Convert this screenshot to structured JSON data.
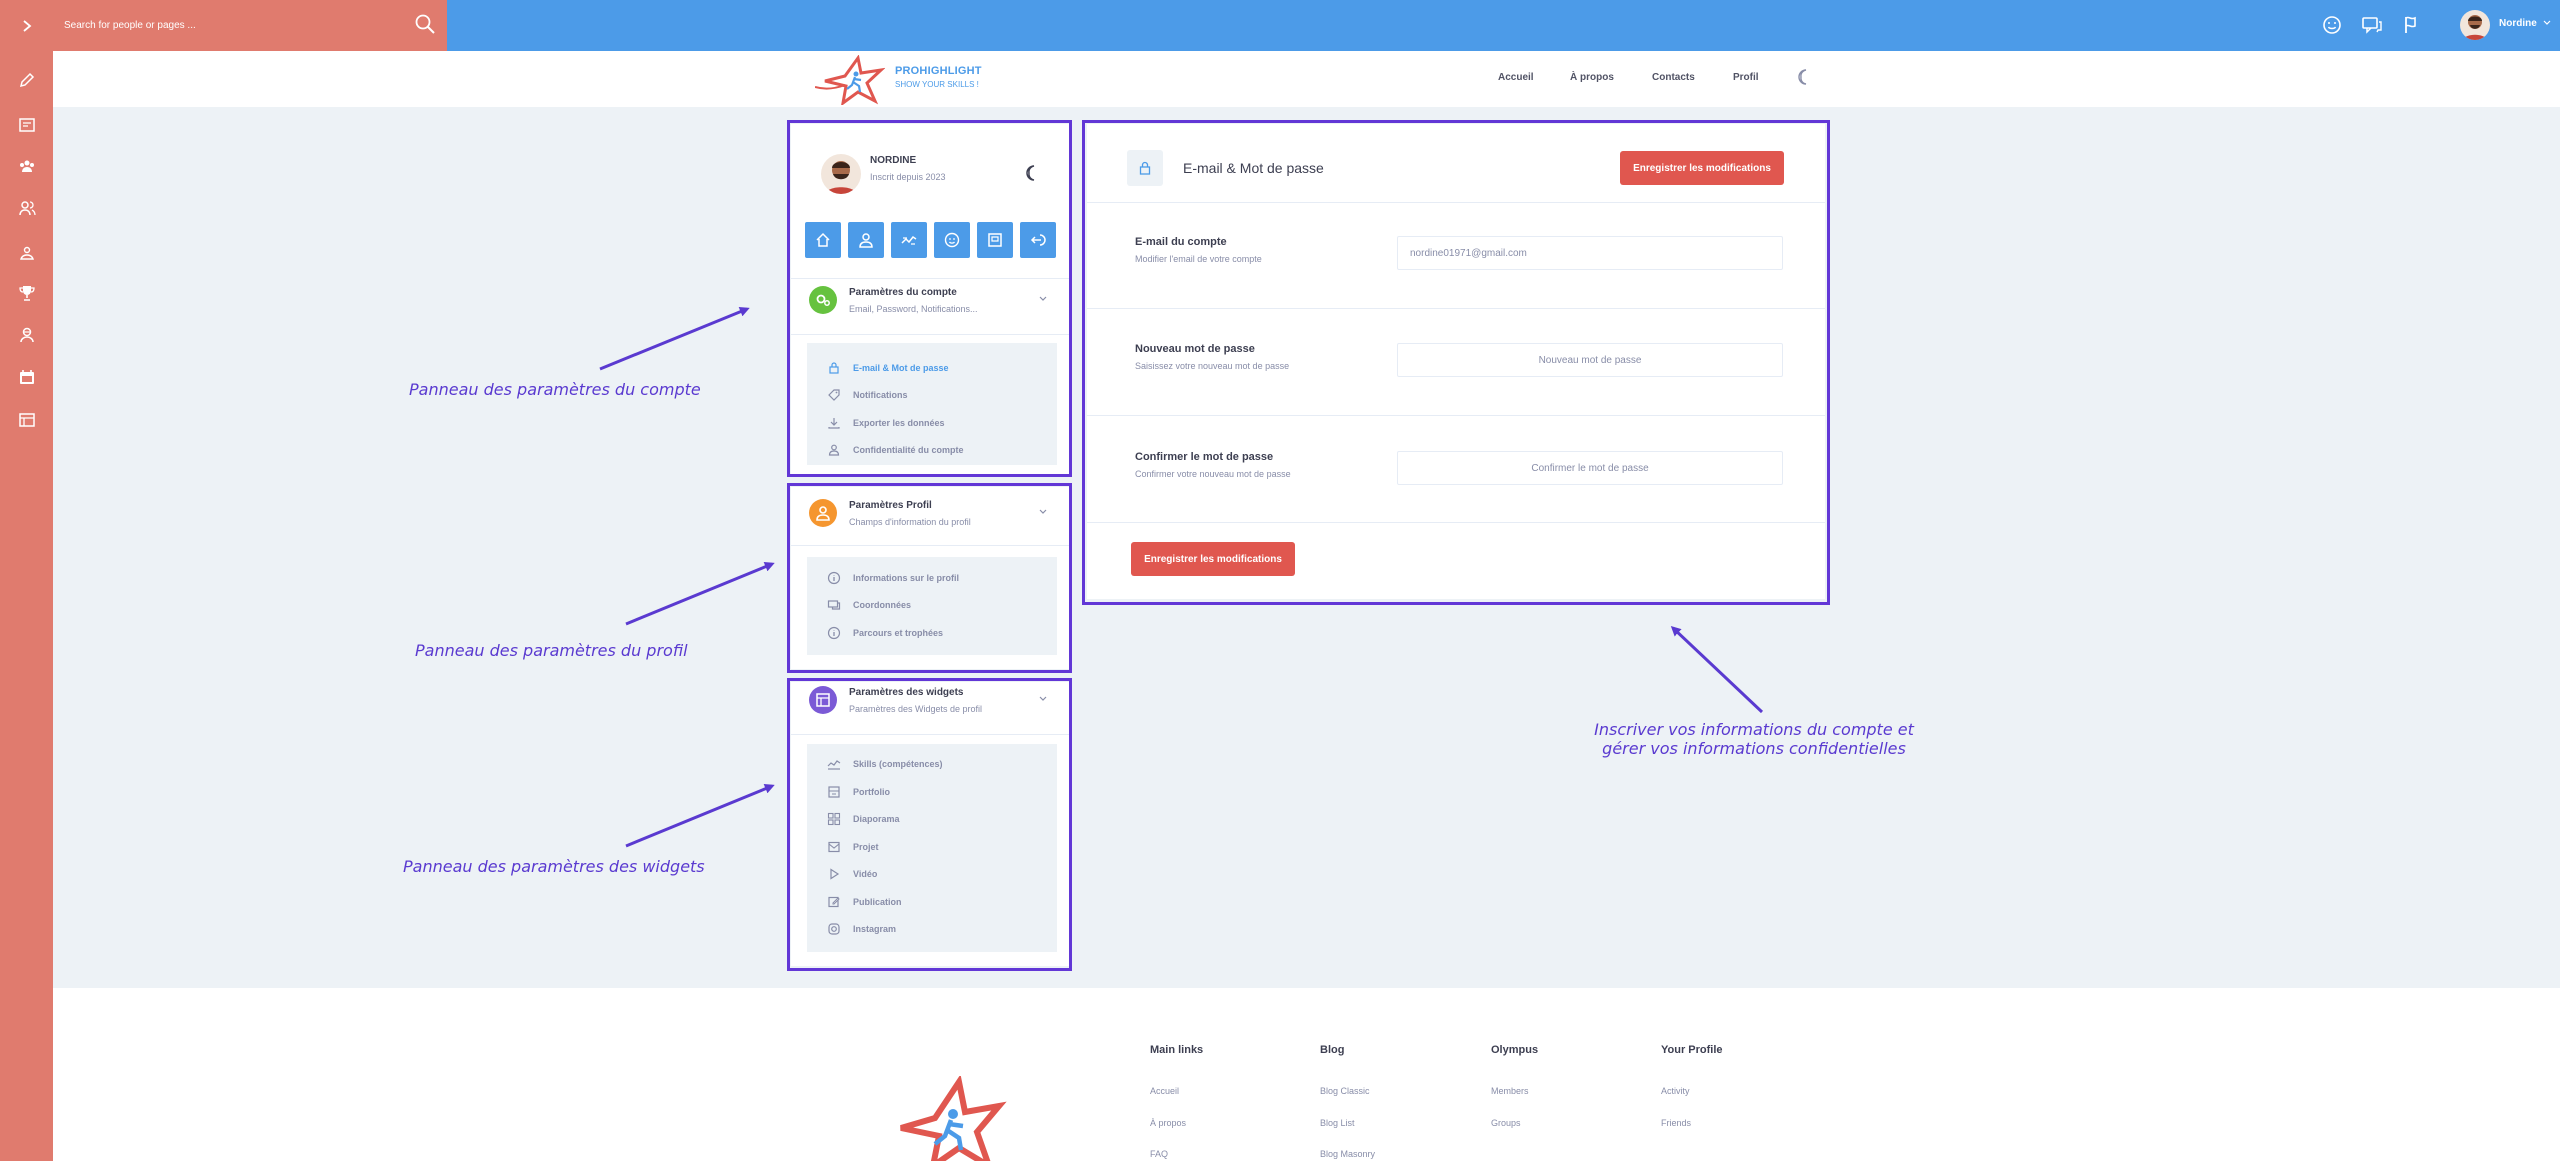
{
  "search": {
    "placeholder": "Search for people or pages ..."
  },
  "user": {
    "name": "Nordine"
  },
  "brand": {
    "name": "PROHIGHLIGHT",
    "tagline": "SHOW YOUR SKILLS !"
  },
  "nav": {
    "home": "Accueil",
    "about": "À propos",
    "contacts": "Contacts",
    "profile": "Profil"
  },
  "profile": {
    "name": "NORDINE",
    "since": "Inscrit depuis 2023"
  },
  "account_settings": {
    "title": "Paramètres du compte",
    "subtitle": "Email, Password, Notifications...",
    "items": [
      "E-mail & Mot de passe",
      "Notifications",
      "Exporter les données",
      "Confidentialité du compte"
    ]
  },
  "profile_settings": {
    "title": "Paramètres Profil",
    "subtitle": "Champs d'information du profil",
    "items": [
      "Informations sur le profil",
      "Coordonnées",
      "Parcours et trophées"
    ]
  },
  "widget_settings": {
    "title": "Paramètres des widgets",
    "subtitle": "Paramètres des Widgets de profil",
    "items": [
      "Skills (compétences)",
      "Portfolio",
      "Diaporama",
      "Projet",
      "Vidéo",
      "Publication",
      "Instagram"
    ]
  },
  "form": {
    "title": "E-mail & Mot de passe",
    "save_label": "Enregistrer les modifications",
    "email_label": "E-mail du compte",
    "email_help": "Modifier l'email de votre compte",
    "email_value": "nordine01971@gmail.com",
    "newpass_label": "Nouveau mot de passe",
    "newpass_help": "Saisissez votre nouveau mot de passe",
    "newpass_placeholder": "Nouveau mot de passe",
    "confirm_label": "Confirmer le mot de passe",
    "confirm_help": "Confirmer votre nouveau mot de passe",
    "confirm_placeholder": "Confirmer le mot de passe"
  },
  "annotations": {
    "account": "Panneau des paramètres du compte",
    "profile": "Panneau des paramètres du profil",
    "widgets": "Panneau des paramètres des widgets",
    "form_line1": "Inscriver vos informations du compte et",
    "form_line2": "gérer vos informations confidentielles"
  },
  "footer": {
    "columns": [
      {
        "title": "Main links",
        "links": [
          "Accueil",
          "À propos",
          "FAQ"
        ]
      },
      {
        "title": "Blog",
        "links": [
          "Blog Classic",
          "Blog List",
          "Blog Masonry"
        ]
      },
      {
        "title": "Olympus",
        "links": [
          "Members",
          "Groups"
        ]
      },
      {
        "title": "Your Profile",
        "links": [
          "Activity",
          "Friends"
        ]
      }
    ]
  },
  "colors": {
    "primary": "#4c9be8",
    "accent": "#e07b6e",
    "danger": "#e0574f",
    "annotation": "#5a3ad0",
    "background": "#edf2f6"
  }
}
